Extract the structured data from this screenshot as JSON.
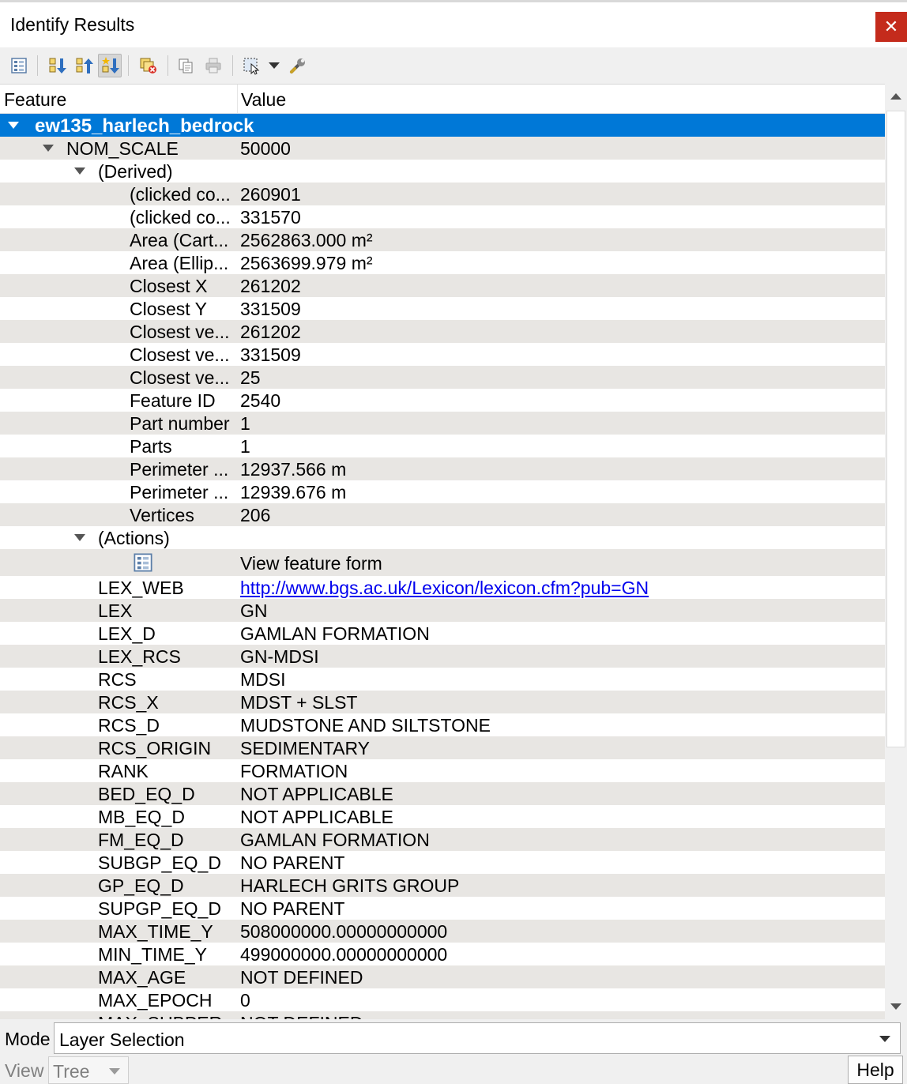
{
  "window": {
    "title": "Identify Results",
    "close_glyph": "✕"
  },
  "toolbar": {
    "buttons": [
      {
        "name": "view-feature-form-button",
        "icon": "form-icon"
      },
      {
        "name": "expand-tree-button",
        "icon": "expand-icon"
      },
      {
        "name": "collapse-tree-button",
        "icon": "collapse-icon"
      },
      {
        "name": "expand-new-results-button",
        "icon": "expand-new-icon",
        "pressed": true
      },
      {
        "name": "clear-results-button",
        "icon": "clear-results-icon"
      },
      {
        "name": "copy-feature-button",
        "icon": "copy-icon"
      },
      {
        "name": "print-button",
        "icon": "print-icon"
      },
      {
        "name": "identify-mode-button",
        "icon": "identify-select-icon"
      },
      {
        "name": "settings-button",
        "icon": "wrench-icon"
      }
    ]
  },
  "tree": {
    "header": {
      "feature": "Feature",
      "value": "Value"
    },
    "rows": [
      {
        "level": 0,
        "expanded": true,
        "feature": "ew135_harlech_bedrock",
        "value": "",
        "selected": true
      },
      {
        "level": 1,
        "expanded": true,
        "feature": "NOM_SCALE",
        "value": "50000"
      },
      {
        "level": 2,
        "expanded": true,
        "feature": "(Derived)",
        "value": ""
      },
      {
        "level": 3,
        "feature": "(clicked co...",
        "value": "260901"
      },
      {
        "level": 3,
        "feature": "(clicked co...",
        "value": "331570"
      },
      {
        "level": 3,
        "feature": "Area (Cart...",
        "value": "2562863.000 m²"
      },
      {
        "level": 3,
        "feature": "Area (Ellip...",
        "value": "2563699.979 m²"
      },
      {
        "level": 3,
        "feature": "Closest X",
        "value": "261202"
      },
      {
        "level": 3,
        "feature": "Closest Y",
        "value": "331509"
      },
      {
        "level": 3,
        "feature": "Closest ve...",
        "value": "261202"
      },
      {
        "level": 3,
        "feature": "Closest ve...",
        "value": "331509"
      },
      {
        "level": 3,
        "feature": "Closest ve...",
        "value": "25"
      },
      {
        "level": 3,
        "feature": "Feature ID",
        "value": "2540"
      },
      {
        "level": 3,
        "feature": "Part number",
        "value": "1"
      },
      {
        "level": 3,
        "feature": "Parts",
        "value": "1"
      },
      {
        "level": 3,
        "feature": "Perimeter ...",
        "value": "12937.566 m"
      },
      {
        "level": 3,
        "feature": "Perimeter ...",
        "value": "12939.676 m"
      },
      {
        "level": 3,
        "feature": "Vertices",
        "value": "206"
      },
      {
        "level": 2,
        "expanded": true,
        "feature": "(Actions)",
        "value": ""
      },
      {
        "level": 3,
        "action": true,
        "icon": "form-icon",
        "feature": "",
        "value": "View feature form"
      },
      {
        "level": 2,
        "feature": "LEX_WEB",
        "value": "http://www.bgs.ac.uk/Lexicon/lexicon.cfm?pub=GN",
        "link": true
      },
      {
        "level": 2,
        "feature": "LEX",
        "value": "GN"
      },
      {
        "level": 2,
        "feature": "LEX_D",
        "value": "GAMLAN FORMATION"
      },
      {
        "level": 2,
        "feature": "LEX_RCS",
        "value": "GN-MDSI"
      },
      {
        "level": 2,
        "feature": "RCS",
        "value": "MDSI"
      },
      {
        "level": 2,
        "feature": "RCS_X",
        "value": "MDST + SLST"
      },
      {
        "level": 2,
        "feature": "RCS_D",
        "value": "MUDSTONE AND SILTSTONE"
      },
      {
        "level": 2,
        "feature": "RCS_ORIGIN",
        "value": "SEDIMENTARY"
      },
      {
        "level": 2,
        "feature": "RANK",
        "value": "FORMATION"
      },
      {
        "level": 2,
        "feature": "BED_EQ_D",
        "value": "NOT APPLICABLE"
      },
      {
        "level": 2,
        "feature": "MB_EQ_D",
        "value": "NOT APPLICABLE"
      },
      {
        "level": 2,
        "feature": "FM_EQ_D",
        "value": "GAMLAN FORMATION"
      },
      {
        "level": 2,
        "feature": "SUBGP_EQ_D",
        "value": "NO PARENT"
      },
      {
        "level": 2,
        "feature": "GP_EQ_D",
        "value": "HARLECH GRITS GROUP"
      },
      {
        "level": 2,
        "feature": "SUPGP_EQ_D",
        "value": "NO PARENT"
      },
      {
        "level": 2,
        "feature": "MAX_TIME_Y",
        "value": "508000000.00000000000"
      },
      {
        "level": 2,
        "feature": "MIN_TIME_Y",
        "value": "499000000.00000000000"
      },
      {
        "level": 2,
        "feature": "MAX_AGE",
        "value": "NOT DEFINED"
      },
      {
        "level": 2,
        "feature": "MAX_EPOCH",
        "value": "0"
      },
      {
        "level": 2,
        "feature": "MAX_SUBPER",
        "value": "NOT DEFINED"
      }
    ]
  },
  "bottom": {
    "mode_label": "Mode",
    "mode_value": "Layer Selection",
    "view_label": "View",
    "view_value": "Tree",
    "help_label": "Help"
  },
  "colors": {
    "selection": "#0078d7",
    "alt_row": "#e8e6e3",
    "close_button": "#c42b1c",
    "link": "#0000ee"
  }
}
